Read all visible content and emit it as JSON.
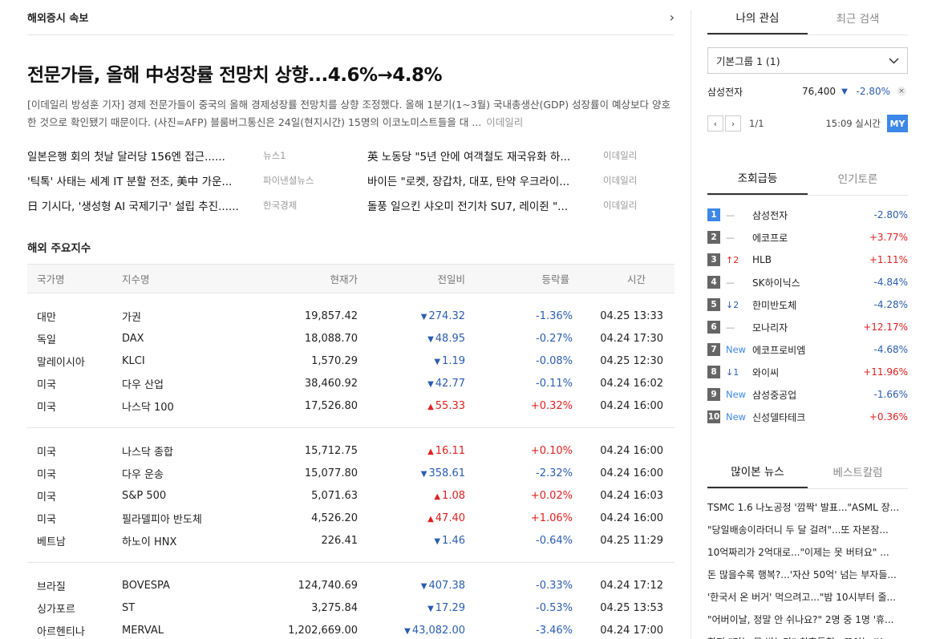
{
  "breaking": {
    "title": "해외증시 속보",
    "chevron": "›"
  },
  "headline": "전문가들, 올해 中성장률 전망치 상향...4.6%→4.8%",
  "summary": {
    "text": "[이데일리 방성훈 기자] 경제 전문가들이 중국의 올해 경제성장률 전망치를 상향 조정했다. 올해 1분기(1~3월) 국내총생산(GDP) 성장률이 예상보다 양호한 것으로 확인됐기 때문이다. (사진=AFP) 블룸버그통신은 24일(현지시간) 15명의 이코노미스트들을 대 ...",
    "source": "이데일리"
  },
  "news_grid": [
    {
      "title": "일본은행 회의 첫날 달러당 156엔 접근......",
      "source": "뉴스1"
    },
    {
      "title": "英 노동당 \"5년 안에 여객철도 재국유화 하...",
      "source": "이데일리"
    },
    {
      "title": "'틱톡' 사태는 세계 IT 분할 전조, 美中 가운...",
      "source": "파이낸셜뉴스"
    },
    {
      "title": "바이든 \"로켓, 장갑차, 대포, 탄약 우크라이...",
      "source": "이데일리"
    },
    {
      "title": "日 기시다, '생성형 AI 국제기구' 설립 추진......",
      "source": "한국경제"
    },
    {
      "title": "돌풍 일으킨 샤오미 전기차 SU7, 레이쥔 \"...",
      "source": "이데일리"
    }
  ],
  "indices": {
    "title": "해외 주요지수",
    "headers": [
      "국가명",
      "지수명",
      "현재가",
      "전일비",
      "등락률",
      "시간"
    ],
    "groups": [
      [
        {
          "country": "대만",
          "name": "가권",
          "price": "19,857.42",
          "dir": "down",
          "change": "274.32",
          "rate": "-1.36%",
          "time": "04.25 13:33"
        },
        {
          "country": "독일",
          "name": "DAX",
          "price": "18,088.70",
          "dir": "down",
          "change": "48.95",
          "rate": "-0.27%",
          "time": "04.24 17:30"
        },
        {
          "country": "말레이시아",
          "name": "KLCI",
          "price": "1,570.29",
          "dir": "down",
          "change": "1.19",
          "rate": "-0.08%",
          "time": "04.25 12:30"
        },
        {
          "country": "미국",
          "name": "다우 산업",
          "price": "38,460.92",
          "dir": "down",
          "change": "42.77",
          "rate": "-0.11%",
          "time": "04.24 16:02"
        },
        {
          "country": "미국",
          "name": "나스닥 100",
          "price": "17,526.80",
          "dir": "up",
          "change": "55.33",
          "rate": "+0.32%",
          "time": "04.24 16:00"
        }
      ],
      [
        {
          "country": "미국",
          "name": "나스닥 종합",
          "price": "15,712.75",
          "dir": "up",
          "change": "16.11",
          "rate": "+0.10%",
          "time": "04.24 16:00"
        },
        {
          "country": "미국",
          "name": "다우 운송",
          "price": "15,077.80",
          "dir": "down",
          "change": "358.61",
          "rate": "-2.32%",
          "time": "04.24 16:00"
        },
        {
          "country": "미국",
          "name": "S&P 500",
          "price": "5,071.63",
          "dir": "up",
          "change": "1.08",
          "rate": "+0.02%",
          "time": "04.24 16:03"
        },
        {
          "country": "미국",
          "name": "필라델피아 반도체",
          "price": "4,526.20",
          "dir": "up",
          "change": "47.40",
          "rate": "+1.06%",
          "time": "04.24 16:00"
        },
        {
          "country": "베트남",
          "name": "하노이 HNX",
          "price": "226.41",
          "dir": "down",
          "change": "1.46",
          "rate": "-0.64%",
          "time": "04.25 11:29"
        }
      ],
      [
        {
          "country": "브라질",
          "name": "BOVESPA",
          "price": "124,740.69",
          "dir": "down",
          "change": "407.38",
          "rate": "-0.33%",
          "time": "04.24 17:12"
        },
        {
          "country": "싱가포르",
          "name": "ST",
          "price": "3,275.84",
          "dir": "down",
          "change": "17.29",
          "rate": "-0.53%",
          "time": "04.25 13:53"
        },
        {
          "country": "아르헨티나",
          "name": "MERVAL",
          "price": "1,202,669.00",
          "dir": "down",
          "change": "43,082.00",
          "rate": "-3.46%",
          "time": "04.24 17:00"
        }
      ]
    ]
  },
  "my_interest": {
    "tabs": [
      "나의 관심",
      "최근 검색"
    ],
    "group_label": "기본그룹 1 (1)",
    "stock": {
      "name": "삼성전자",
      "price": "76,400",
      "arrow": "▼",
      "rate": "-2.80%",
      "remove": "×"
    },
    "pager": {
      "prev": "‹",
      "next": "›",
      "page": "1/1",
      "time": "15:09 실시간",
      "my": "MY"
    }
  },
  "ranking": {
    "tabs": [
      "조회급등",
      "인기토론"
    ],
    "items": [
      {
        "rank": "1",
        "chg": "—",
        "chg_type": "none",
        "name": "삼성전자",
        "rate": "-2.80%",
        "dir": "down"
      },
      {
        "rank": "2",
        "chg": "—",
        "chg_type": "none",
        "name": "에코프로",
        "rate": "+3.77%",
        "dir": "up"
      },
      {
        "rank": "3",
        "chg": "↑2",
        "chg_type": "up",
        "name": "HLB",
        "rate": "+1.11%",
        "dir": "up"
      },
      {
        "rank": "4",
        "chg": "—",
        "chg_type": "none",
        "name": "SK하이닉스",
        "rate": "-4.84%",
        "dir": "down"
      },
      {
        "rank": "5",
        "chg": "↓2",
        "chg_type": "down",
        "name": "한미반도체",
        "rate": "-4.28%",
        "dir": "down"
      },
      {
        "rank": "6",
        "chg": "—",
        "chg_type": "none",
        "name": "모나리자",
        "rate": "+12.17%",
        "dir": "up"
      },
      {
        "rank": "7",
        "chg": "New",
        "chg_type": "new",
        "name": "에코프로비엠",
        "rate": "-4.68%",
        "dir": "down"
      },
      {
        "rank": "8",
        "chg": "↓1",
        "chg_type": "down",
        "name": "와이씨",
        "rate": "+11.96%",
        "dir": "up"
      },
      {
        "rank": "9",
        "chg": "New",
        "chg_type": "new",
        "name": "삼성중공업",
        "rate": "-1.66%",
        "dir": "down"
      },
      {
        "rank": "10",
        "chg": "New",
        "chg_type": "new",
        "name": "신성델타테크",
        "rate": "+0.36%",
        "dir": "up"
      }
    ]
  },
  "popular_news": {
    "tabs": [
      "많이본 뉴스",
      "베스트칼럼"
    ],
    "items": [
      "TSMC 1.6 나노공정 '깜짝' 발표...\"ASML 장...",
      "\"당일배송이라더니 두 달 걸려\"...또 자본잠...",
      "10억짜리가 2억대로...\"이제는 못 버텨요\" ...",
      "돈 많을수록 행복?...'자산 50억' 넘는 부자들...",
      "'한국서 온 버거' 먹으려고...\"밤 10시부터 줄...",
      "\"어버이날, 정말 안 쉬나요?\" 2명 중 1명 '휴...",
      "한전 \"더는 못 받는다\" 최후통첩...꼬이는 'K..."
    ]
  },
  "colors": {
    "up": "#e02020",
    "down": "#2a5db0",
    "accent": "#3d87e8"
  }
}
